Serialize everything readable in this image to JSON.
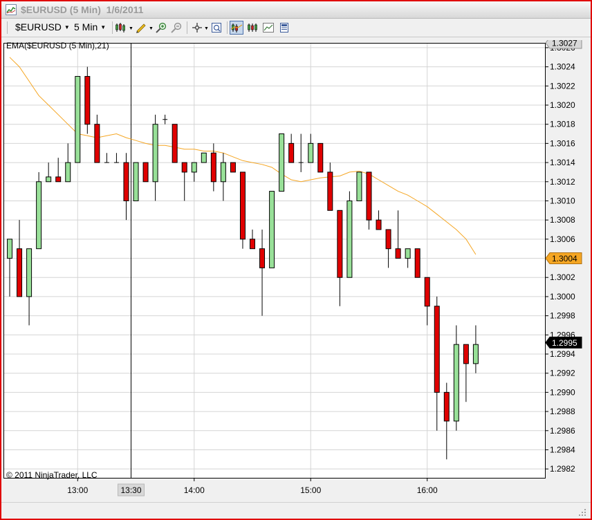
{
  "window": {
    "title": "$EURUSD (5 Min)  1/6/2011"
  },
  "toolbar": {
    "instrument": "$EURUSD",
    "interval": "5 Min",
    "buttons": [
      {
        "name": "bar-type-icon"
      },
      {
        "name": "drawing-tools-icon"
      },
      {
        "name": "zoom-in-icon"
      },
      {
        "name": "zoom-out-icon"
      },
      {
        "name": "crosshair-icon"
      },
      {
        "name": "properties-icon"
      },
      {
        "name": "indicators-icon"
      },
      {
        "name": "strategies-icon"
      },
      {
        "name": "data-series-icon"
      },
      {
        "name": "chart-trader-icon"
      }
    ]
  },
  "chart_data": {
    "type": "candlestick",
    "indicator_label": "EMA($EURUSD (5 Min),21)",
    "copyright": "© 2011 NinjaTrader, LLC",
    "y_range": [
      1.2981,
      1.30265
    ],
    "y_ticks": [
      "1.3026",
      "1.3024",
      "1.3022",
      "1.3020",
      "1.3018",
      "1.3016",
      "1.3014",
      "1.3012",
      "1.3010",
      "1.3008",
      "1.3006",
      "1.3004",
      "1.3002",
      "1.3000",
      "1.2998",
      "1.2996",
      "1.2994",
      "1.2992",
      "1.2990",
      "1.2988",
      "1.2986",
      "1.2984",
      "1.2982"
    ],
    "x_ticks": [
      {
        "label": "13:00",
        "bar": 7
      },
      {
        "label": "14:00",
        "bar": 19
      },
      {
        "label": "15:00",
        "bar": 31
      },
      {
        "label": "16:00",
        "bar": 43
      }
    ],
    "crosshair": {
      "label": "13:30",
      "bar": 12.5
    },
    "price_markers": [
      {
        "label": "1.3027",
        "value": 1.30265,
        "style": "light"
      },
      {
        "label": "1.3004",
        "value": 1.3004,
        "style": "ema"
      },
      {
        "label": "1.2995",
        "value": 1.29952,
        "style": "dark"
      }
    ],
    "ohlc": [
      [
        1.3004,
        1.3006,
        1.3,
        1.3006
      ],
      [
        1.3005,
        1.3008,
        1.3,
        1.3
      ],
      [
        1.3,
        1.3005,
        1.2997,
        1.3005
      ],
      [
        1.3005,
        1.3013,
        1.3005,
        1.3012
      ],
      [
        1.3012,
        1.3014,
        1.3012,
        1.30125
      ],
      [
        1.30125,
        1.30145,
        1.3012,
        1.3012
      ],
      [
        1.3012,
        1.3016,
        1.3012,
        1.3014
      ],
      [
        1.3014,
        1.3023,
        1.3014,
        1.3023
      ],
      [
        1.3023,
        1.3024,
        1.3017,
        1.3018
      ],
      [
        1.3018,
        1.3019,
        1.3014,
        1.3014
      ],
      [
        1.3014,
        1.3015,
        1.3014,
        1.3014
      ],
      [
        1.3014,
        1.3015,
        1.3014,
        1.3014
      ],
      [
        1.3014,
        1.3015,
        1.3008,
        1.301
      ],
      [
        1.301,
        1.3014,
        1.301,
        1.3014
      ],
      [
        1.3014,
        1.3014,
        1.3012,
        1.3012
      ],
      [
        1.3012,
        1.3019,
        1.301,
        1.3018
      ],
      [
        1.30185,
        1.3019,
        1.3018,
        1.30185
      ],
      [
        1.3018,
        1.3018,
        1.3014,
        1.3014
      ],
      [
        1.3014,
        1.3014,
        1.301,
        1.3013
      ],
      [
        1.3013,
        1.3014,
        1.3012,
        1.3014
      ],
      [
        1.3014,
        1.3015,
        1.3014,
        1.3015
      ],
      [
        1.3015,
        1.3016,
        1.3011,
        1.3012
      ],
      [
        1.3012,
        1.3015,
        1.301,
        1.3014
      ],
      [
        1.3014,
        1.3014,
        1.3013,
        1.3013
      ],
      [
        1.3013,
        1.3013,
        1.3005,
        1.3006
      ],
      [
        1.3006,
        1.3007,
        1.3005,
        1.3005
      ],
      [
        1.3005,
        1.3007,
        1.2998,
        1.3003
      ],
      [
        1.3003,
        1.3011,
        1.3003,
        1.3011
      ],
      [
        1.3011,
        1.3017,
        1.3011,
        1.3017
      ],
      [
        1.3016,
        1.3017,
        1.3014,
        1.3014
      ],
      [
        1.3014,
        1.3017,
        1.3013,
        1.3014
      ],
      [
        1.3014,
        1.3017,
        1.3014,
        1.3016
      ],
      [
        1.3016,
        1.3016,
        1.3013,
        1.3013
      ],
      [
        1.3013,
        1.3014,
        1.3009,
        1.3009
      ],
      [
        1.3009,
        1.3009,
        1.2999,
        1.3002
      ],
      [
        1.3002,
        1.3011,
        1.3002,
        1.301
      ],
      [
        1.301,
        1.3013,
        1.301,
        1.3013
      ],
      [
        1.3013,
        1.3013,
        1.3007,
        1.3008
      ],
      [
        1.3008,
        1.3009,
        1.3007,
        1.3007
      ],
      [
        1.3007,
        1.3007,
        1.3003,
        1.3005
      ],
      [
        1.3005,
        1.3009,
        1.3004,
        1.3004
      ],
      [
        1.3004,
        1.3005,
        1.3003,
        1.3005
      ],
      [
        1.3005,
        1.3005,
        1.3002,
        1.3002
      ],
      [
        1.3002,
        1.3002,
        1.2997,
        1.2999
      ],
      [
        1.2999,
        1.3,
        1.2986,
        1.299
      ],
      [
        1.299,
        1.2991,
        1.2983,
        1.2987
      ],
      [
        1.2987,
        1.2997,
        1.2986,
        1.2995
      ],
      [
        1.2995,
        1.2995,
        1.2989,
        1.2993
      ],
      [
        1.2993,
        1.2997,
        1.2992,
        1.2995
      ]
    ],
    "ema": [
      1.3025,
      1.3024,
      1.30225,
      1.3021,
      1.302,
      1.3019,
      1.3018,
      1.3017,
      1.30168,
      1.30166,
      1.30168,
      1.3017,
      1.30166,
      1.30163,
      1.3016,
      1.30158,
      1.30158,
      1.30156,
      1.30154,
      1.30154,
      1.30152,
      1.30152,
      1.3015,
      1.30146,
      1.30142,
      1.3014,
      1.30138,
      1.30135,
      1.30128,
      1.30122,
      1.3012,
      1.30122,
      1.30124,
      1.30125,
      1.30126,
      1.3013,
      1.30131,
      1.30128,
      1.30122,
      1.30116,
      1.3011,
      1.30106,
      1.301,
      1.30094,
      1.30086,
      1.30078,
      1.3007,
      1.3006,
      1.30044
    ]
  }
}
